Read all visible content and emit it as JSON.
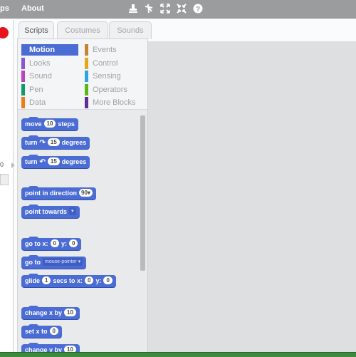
{
  "menu": {
    "partial_item": "ps",
    "about_label": "About"
  },
  "toolbar_icons": [
    "stamp-icon",
    "cut-icon",
    "grow-icon",
    "shrink-icon",
    "help-icon"
  ],
  "stage": {
    "coord_text": "0"
  },
  "tabs": [
    {
      "label": "Scripts",
      "active": true
    },
    {
      "label": "Costumes",
      "active": false
    },
    {
      "label": "Sounds",
      "active": false
    }
  ],
  "categories": [
    {
      "label": "Motion",
      "color": "#4a6cd4",
      "selected": true
    },
    {
      "label": "Looks",
      "color": "#8a55d7"
    },
    {
      "label": "Sound",
      "color": "#bb42c3"
    },
    {
      "label": "Pen",
      "color": "#0e9a6c"
    },
    {
      "label": "Data",
      "color": "#ee7d16"
    },
    {
      "label": "Events",
      "color": "#c88330"
    },
    {
      "label": "Control",
      "color": "#e1a91a"
    },
    {
      "label": "Sensing",
      "color": "#2ca5e2"
    },
    {
      "label": "Operators",
      "color": "#5cb712"
    },
    {
      "label": "More Blocks",
      "color": "#632d99"
    }
  ],
  "blocks": {
    "move": {
      "w1": "move",
      "v": "10",
      "w2": "steps"
    },
    "turn_right": {
      "w1": "turn",
      "v": "15",
      "w2": "degrees"
    },
    "turn_left": {
      "w1": "turn",
      "v": "15",
      "w2": "degrees"
    },
    "point_dir": {
      "w1": "point in direction",
      "v": "90▾"
    },
    "point_towards": {
      "w1": "point towards",
      "v": "▾"
    },
    "goto_xy": {
      "w1": "go to x:",
      "x": "0",
      "w2": "y:",
      "y": "0"
    },
    "goto": {
      "w1": "go to",
      "v": "mouse-pointer ▾"
    },
    "glide": {
      "w1": "glide",
      "s": "1",
      "w2": "secs to x:",
      "x": "0",
      "w3": "y:",
      "y": "0"
    },
    "change_x": {
      "w1": "change x by",
      "v": "10"
    },
    "set_x": {
      "w1": "set x to",
      "v": "0"
    },
    "change_y": {
      "w1": "change y by",
      "v": "10"
    }
  },
  "colors": {
    "motion": "#4a6cd4",
    "stop": "#e8141b",
    "topbar": "#9a9c9e"
  }
}
